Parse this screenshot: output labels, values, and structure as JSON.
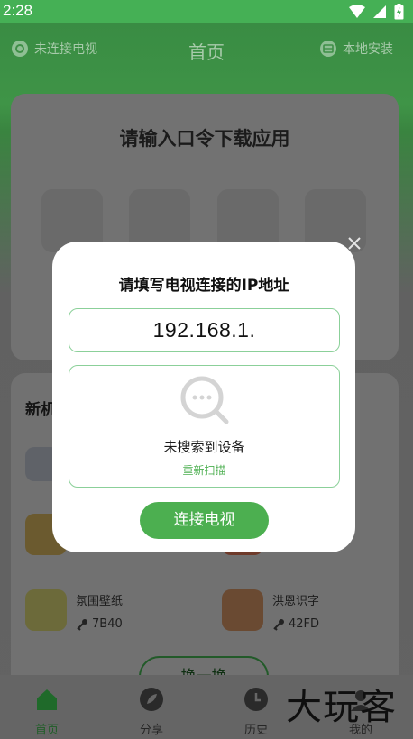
{
  "status_bar": {
    "time": "2:28"
  },
  "header": {
    "tv_status": "未连接电视",
    "title": "首页",
    "local_install": "本地安装"
  },
  "code_card": {
    "heading": "请输入口令下载应用"
  },
  "new_section": {
    "title": "新机",
    "apps": [
      {
        "name": "氛围壁纸",
        "code": "7B40"
      },
      {
        "name": "洪恩识字",
        "code": "42FD"
      }
    ],
    "swap_label": "换一换"
  },
  "bottom_nav": [
    {
      "label": "首页",
      "icon": "home-icon",
      "active": true
    },
    {
      "label": "分享",
      "icon": "share-icon",
      "active": false
    },
    {
      "label": "历史",
      "icon": "history-icon",
      "active": false
    },
    {
      "label": "我的",
      "icon": "profile-icon",
      "active": false
    }
  ],
  "watermark": "大玩客",
  "dialog": {
    "title": "请填写电视连接的IP地址",
    "ip_value": "192.168.1.",
    "no_device": "未搜索到设备",
    "rescan": "重新扫描",
    "connect": "连接电视"
  },
  "colors": {
    "accent": "#4caf50",
    "status_bar": "#45b055"
  }
}
